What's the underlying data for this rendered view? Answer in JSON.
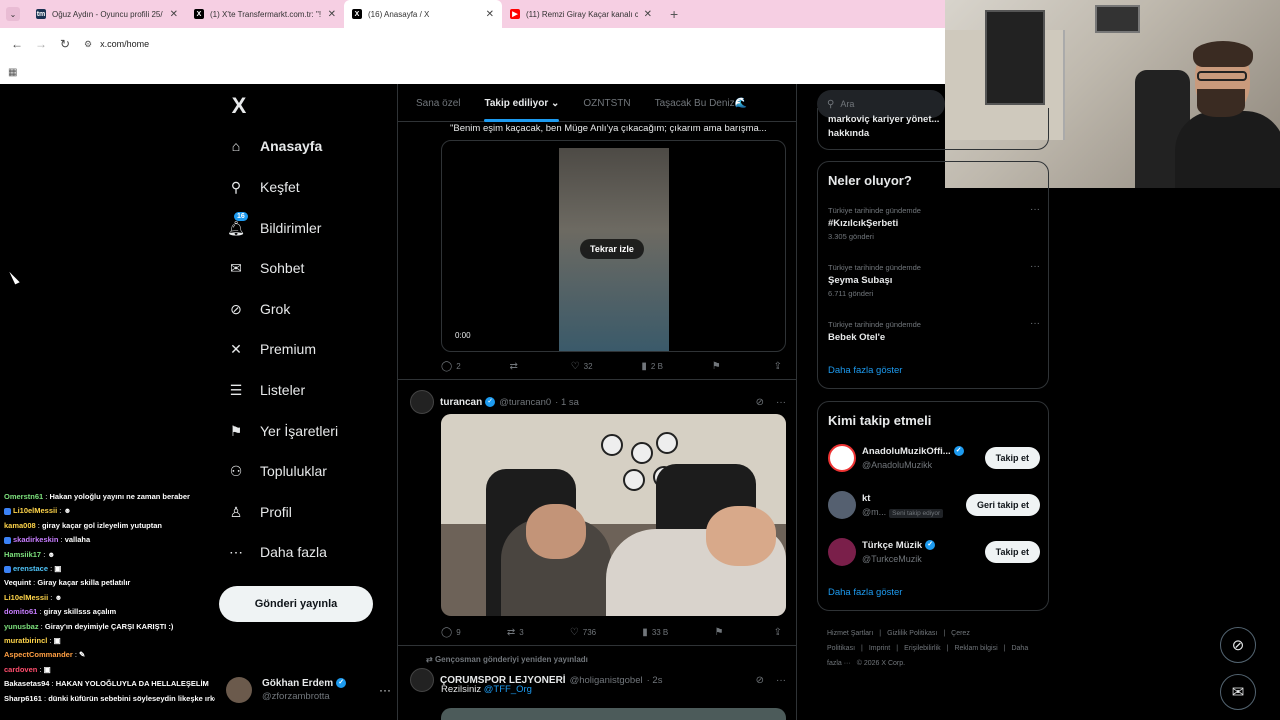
{
  "browser": {
    "tabs": [
      {
        "title": "Oğuz Aydın - Oyuncu profili 25/",
        "favicon": "tm",
        "color": "#1a3151",
        "active": false
      },
      {
        "title": "(1) X'te Transfermarkt.com.tr: \"!",
        "favicon": "X",
        "color": "#000000",
        "active": false
      },
      {
        "title": "(16) Anasayfa / X",
        "favicon": "X",
        "color": "#000000",
        "active": true
      },
      {
        "title": "(11) Remzi Giray Kaçar kanalı ca",
        "favicon": "▶",
        "color": "#ff0000",
        "active": false
      }
    ],
    "new_tab": "+",
    "url": "x.com/home"
  },
  "chat": [
    {
      "user": "Omerstn61",
      "color": "#7ce07c",
      "text": "Hakan yoloğlu yayını ne zaman beraber",
      "badge": ""
    },
    {
      "user": "Li10elMessii",
      "color": "#ffd54a",
      "text": "☻",
      "badge": "#3b82f6"
    },
    {
      "user": "kama008",
      "color": "#ffd54a",
      "text": "giray kaçar gol izleyelim yutuptan",
      "badge": ""
    },
    {
      "user": "skadirkeskin",
      "color": "#c77dff",
      "text": "vallaha",
      "badge": "#3b82f6"
    },
    {
      "user": "Hamsiik17",
      "color": "#7ce07c",
      "text": "☻",
      "badge": ""
    },
    {
      "user": "erenstace",
      "color": "#4fc3f7",
      "text": "▣",
      "badge": "#3b82f6"
    },
    {
      "user": "Vequint",
      "color": "#ffffff",
      "text": "Giray kaçar skilla petlatılır",
      "badge": ""
    },
    {
      "user": "Li10elMessii",
      "color": "#ffd54a",
      "text": "☻",
      "badge": ""
    },
    {
      "user": "domito61",
      "color": "#c77dff",
      "text": "giray skillsss açalım",
      "badge": ""
    },
    {
      "user": "yunusbaz",
      "color": "#7ce07c",
      "text": "Giray'ın deyimiyle ÇARŞI KARIŞTI :)",
      "badge": ""
    },
    {
      "user": "muratbirincl",
      "color": "#ffd54a",
      "text": "▣",
      "badge": ""
    },
    {
      "user": "AspectCommander",
      "color": "#ff9f43",
      "text": "✎",
      "badge": ""
    },
    {
      "user": "cardoven",
      "color": "#ff4d6d",
      "text": "▣",
      "badge": ""
    },
    {
      "user": "Bakasetas94",
      "color": "#ffffff",
      "text": "HAKAN YOLOĞLUYLA DA HELLALEŞELİM",
      "badge": ""
    },
    {
      "user": "Sharp6161",
      "color": "#ffffff",
      "text": "dünki küfürün sebebini söyleseydin likeşke ırkçılık olayını",
      "badge": ""
    }
  ],
  "nav": {
    "logo": "X",
    "items": [
      {
        "label": "Anasayfa",
        "icon": "home-icon",
        "glyph": "⌂",
        "bold": true
      },
      {
        "label": "Keşfet",
        "icon": "search-icon",
        "glyph": "⚲",
        "bold": false
      },
      {
        "label": "Bildirimler",
        "icon": "bell-icon",
        "glyph": "🔔︎",
        "bold": false,
        "badge": "16"
      },
      {
        "label": "Sohbet",
        "icon": "envelope-icon",
        "glyph": "✉",
        "bold": false
      },
      {
        "label": "Grok",
        "icon": "grok-icon",
        "glyph": "⊘",
        "bold": false
      },
      {
        "label": "Premium",
        "icon": "x-premium-icon",
        "glyph": "✕",
        "bold": false
      },
      {
        "label": "Listeler",
        "icon": "list-icon",
        "glyph": "☰",
        "bold": false
      },
      {
        "label": "Yer İşaretleri",
        "icon": "bookmark-icon",
        "glyph": "⚑",
        "bold": false
      },
      {
        "label": "Topluluklar",
        "icon": "communities-icon",
        "glyph": "⚇",
        "bold": false
      },
      {
        "label": "Profil",
        "icon": "profile-icon",
        "glyph": "♙",
        "bold": false
      },
      {
        "label": "Daha fazla",
        "icon": "more-circle-icon",
        "glyph": "⋯",
        "bold": false
      }
    ],
    "post_button": "Gönderi yayınla",
    "account": {
      "name": "Gökhan Erdem",
      "handle": "@zforzambrotta",
      "more": "···"
    }
  },
  "feed": {
    "tabs": [
      {
        "label": "Sana özel",
        "active": false
      },
      {
        "label": "Takip ediliyor ⌄",
        "active": true
      },
      {
        "label": "OZNTSTN",
        "active": false
      },
      {
        "label": "Taşacak Bu Deniz🌊",
        "active": false
      }
    ],
    "posts": [
      {
        "quote_text": "\"Benim eşim kaçacak, ben Müge Anlı'ya çıkacağım; çıkarım ama barışma...",
        "replay_label": "Tekrar izle",
        "video_time": "0:00",
        "replies": "2",
        "reposts": "",
        "likes": "32",
        "views": "2 B"
      },
      {
        "name": "turancan",
        "handle": "@turancan0",
        "time": "· 1 sa",
        "replies": "9",
        "reposts": "3",
        "likes": "736",
        "views": "33 B"
      },
      {
        "repost_label": "Gençosman gönderiyi yeniden yayınladı",
        "name": "ÇORUMSPOR LEJYONERİ",
        "handle": "@holiganistgobel",
        "time": "· 2s",
        "text": "Rezilsiniz ",
        "mention": "@TFF_Org"
      }
    ]
  },
  "right": {
    "search_placeholder": "Ara",
    "top_snippet": "hakkında",
    "top_snippet_cut": "markoviç kariyer yönet...",
    "trends_title": "Neler oluyor?",
    "trends": [
      {
        "context": "Türkiye tarihinde gündemde",
        "name": "#KızılcıkŞerbeti",
        "count": "3.305 gönderi"
      },
      {
        "context": "Türkiye tarihinde gündemde",
        "name": "Şeyma Subaşı",
        "count": "6.711 gönderi"
      },
      {
        "context": "Türkiye tarihinde gündemde",
        "name": "Bebek Otel'e",
        "count": ""
      }
    ],
    "show_more": "Daha fazla göster",
    "who_title": "Kimi takip etmeli",
    "who": [
      {
        "name": "AnadoluMuzikOffi...",
        "handle": "@AnadoluMuzikk",
        "button": "Takip et",
        "badge": "",
        "verified": true,
        "avatar": "#ffffff"
      },
      {
        "name": "kt",
        "handle": "@m...",
        "button": "Geri takip et",
        "badge": "Seni takip ediyor",
        "verified": false,
        "avatar": "#556070"
      },
      {
        "name": "Türkçe Müzik",
        "handle": "@TurkceMuzik",
        "button": "Takip et",
        "badge": "",
        "verified": true,
        "avatar": "#7a1f4a"
      }
    ],
    "footer": [
      "Hizmet Şartları",
      "|",
      "Gizlilik Politikası",
      "|",
      "Çerez Politikası",
      "|",
      "Imprint",
      "|",
      "Erişilebilirlik",
      "|",
      "Reklam bilgisi",
      "|",
      "Daha fazla ···",
      "© 2026 X Corp."
    ]
  }
}
